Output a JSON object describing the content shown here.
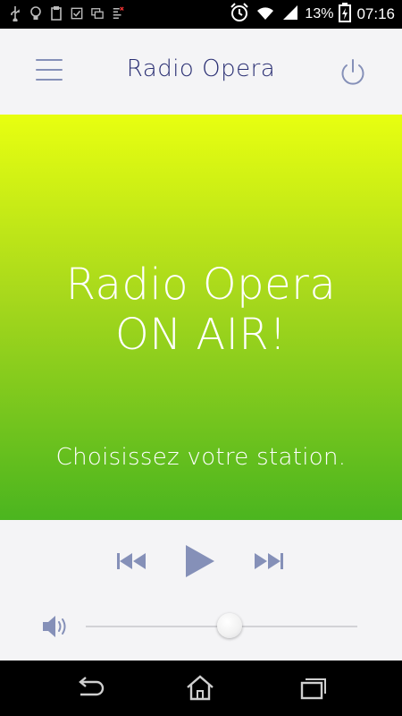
{
  "status_bar": {
    "notification_icons": [
      "usb-icon",
      "bulb-icon",
      "clipboard-icon",
      "checkbox-icon",
      "screens-icon",
      "data-icon"
    ],
    "battery_percent": "13%",
    "time": "07:16"
  },
  "header": {
    "title": "Radio Opera",
    "menu_icon": "hamburger-menu-icon",
    "power_icon": "power-icon"
  },
  "hero": {
    "title_line1": "Radio Opera",
    "title_line2": "ON AIR!",
    "subtitle": "Choisissez votre station."
  },
  "player": {
    "volume_level": 0.53
  },
  "colors": {
    "accent": "#8590b8",
    "title_text": "#2a2f73",
    "gradient_top": "#e8ff10",
    "gradient_bottom": "#4bb51f"
  }
}
